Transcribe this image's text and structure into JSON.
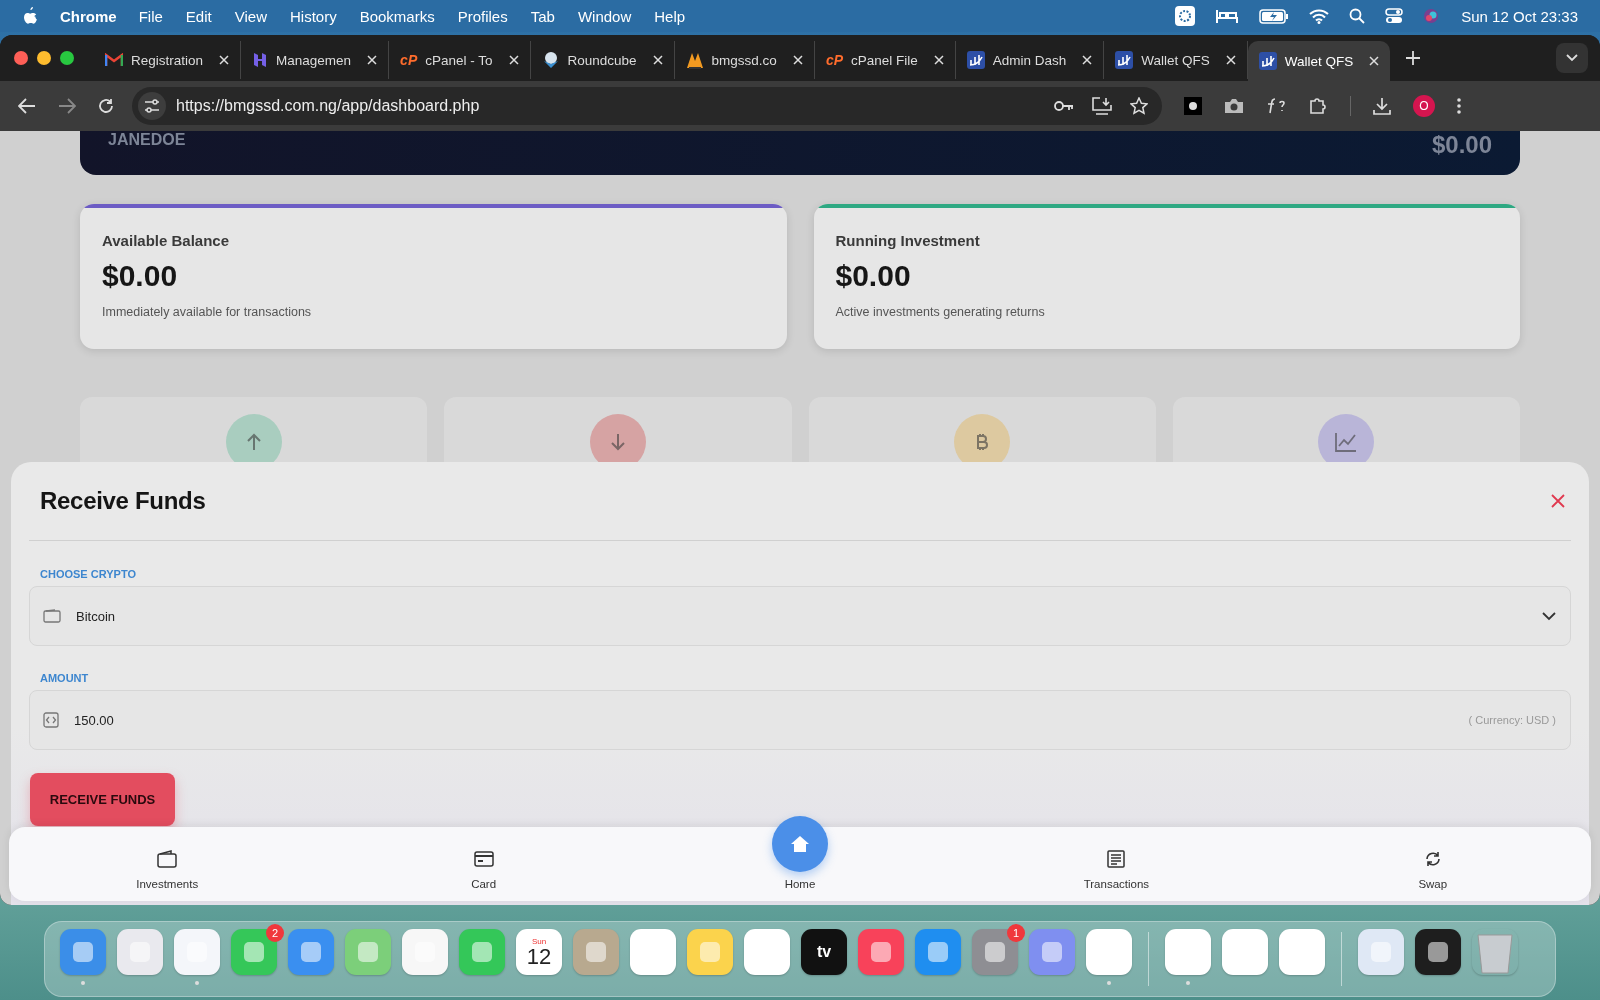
{
  "menu_bar": {
    "app": "Chrome",
    "items": [
      "File",
      "Edit",
      "View",
      "History",
      "Bookmarks",
      "Profiles",
      "Tab",
      "Window",
      "Help"
    ],
    "clock": "Sun 12 Oct  23:33"
  },
  "tabs": [
    {
      "title": "Registration",
      "kind": "gmail",
      "selected": false
    },
    {
      "title": "Managemen",
      "kind": "hlogo",
      "selected": false
    },
    {
      "title": "cPanel - To",
      "kind": "cpanel",
      "icon_text": "cP",
      "selected": false
    },
    {
      "title": "Roundcube",
      "kind": "cube",
      "selected": false
    },
    {
      "title": "bmgssd.co",
      "kind": "tower",
      "selected": false
    },
    {
      "title": "cPanel File",
      "kind": "cpanel",
      "icon_text": "cP",
      "selected": false
    },
    {
      "title": "Admin Dash",
      "kind": "chart",
      "selected": false
    },
    {
      "title": "Wallet QFS",
      "kind": "chart",
      "selected": false
    },
    {
      "title": "Wallet QFS",
      "kind": "chart",
      "selected": true
    }
  ],
  "address": {
    "url": "https://bmgssd.com.ng/app/dashboard.php"
  },
  "profile": {
    "initial": "O"
  },
  "banner": {
    "name": "JANEDOE",
    "amount": "$0.00"
  },
  "balances": [
    {
      "title": "Available Balance",
      "amount": "$0.00",
      "caption": "Immediately available for transactions",
      "color": "#6c5cc4"
    },
    {
      "title": "Running Investment",
      "amount": "$0.00",
      "caption": "Active investments generating returns",
      "color": "#2ea882"
    }
  ],
  "actions": [
    {
      "kind": "up",
      "color": "#a9cdbf"
    },
    {
      "kind": "down",
      "color": "#d6a3a3"
    },
    {
      "kind": "bitcoin",
      "color": "#ddc9a0"
    },
    {
      "kind": "chart",
      "color": "#b9b5d8"
    }
  ],
  "modal": {
    "title": "Receive Funds",
    "fields": [
      {
        "kind": "select",
        "label": "CHOOSE CRYPTO",
        "value": "Bitcoin"
      },
      {
        "kind": "input",
        "label": "AMOUNT",
        "value": "150.00",
        "hint": "( Currency: USD )"
      }
    ],
    "button": "RECEIVE FUNDS"
  },
  "bottom_nav": [
    {
      "kind": "wallet",
      "label": "Investments",
      "selected": false
    },
    {
      "kind": "card",
      "label": "Card",
      "selected": false
    },
    {
      "kind": "home",
      "label": "Home",
      "selected": true
    },
    {
      "kind": "list",
      "label": "Transactions",
      "selected": false
    },
    {
      "kind": "swap",
      "label": "Swap",
      "selected": false
    }
  ],
  "dock": [
    {
      "kind": "finder",
      "running": true
    },
    {
      "kind": "launchpad",
      "running": false
    },
    {
      "kind": "safari",
      "running": true
    },
    {
      "kind": "messages",
      "running": false,
      "badge": "2"
    },
    {
      "kind": "mail",
      "running": false
    },
    {
      "kind": "maps",
      "running": false
    },
    {
      "kind": "photos",
      "running": false
    },
    {
      "kind": "facetime",
      "running": false
    },
    {
      "kind": "calendar",
      "running": false,
      "day": "Sun",
      "date": "12"
    },
    {
      "kind": "contacts",
      "running": false
    },
    {
      "kind": "reminders",
      "running": false
    },
    {
      "kind": "notes",
      "running": false
    },
    {
      "kind": "freeform",
      "running": false
    },
    {
      "kind": "tv",
      "running": false,
      "text": "tv"
    },
    {
      "kind": "music",
      "running": false
    },
    {
      "kind": "appstore",
      "running": false
    },
    {
      "kind": "settings",
      "running": false,
      "badge": "1"
    },
    {
      "kind": "simulator",
      "running": false
    },
    {
      "kind": "textedit",
      "running": true
    },
    {
      "kind": "sep"
    },
    {
      "kind": "chrome",
      "running": true
    },
    {
      "kind": "qbrowser",
      "running": false
    },
    {
      "kind": "capcut",
      "running": false
    },
    {
      "kind": "sep"
    },
    {
      "kind": "doc",
      "running": false
    },
    {
      "kind": "terminal",
      "running": false
    },
    {
      "kind": "trash",
      "running": false
    }
  ]
}
